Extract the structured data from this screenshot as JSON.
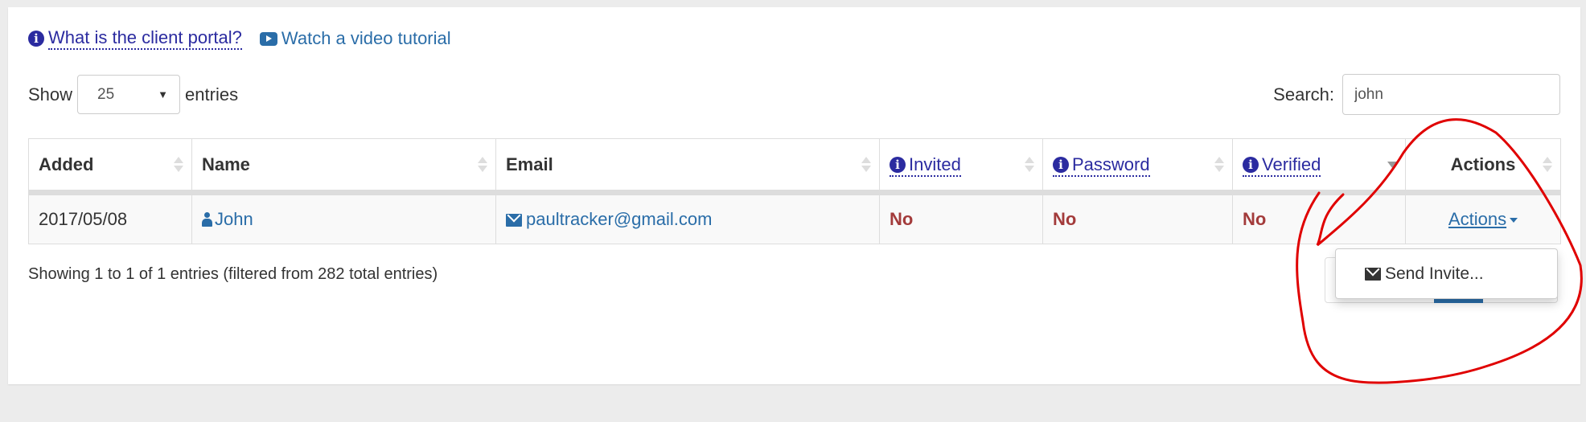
{
  "help_links": {
    "client_portal": {
      "label": "What is the client portal?",
      "icon": "info-circle-icon"
    },
    "video_tutorial": {
      "label": "Watch a video tutorial",
      "icon": "youtube-play-icon"
    }
  },
  "length_control": {
    "prefix": "Show",
    "value": "25",
    "suffix": "entries"
  },
  "search": {
    "label": "Search:",
    "value": "john"
  },
  "table": {
    "columns": [
      {
        "label": "Added",
        "sort": "none"
      },
      {
        "label": "Name",
        "sort": "none"
      },
      {
        "label": "Email",
        "sort": "none"
      },
      {
        "label": "Invited",
        "sort": "none",
        "info": true
      },
      {
        "label": "Password",
        "sort": "none",
        "info": true
      },
      {
        "label": "Verified",
        "sort": "desc",
        "info": true
      },
      {
        "label": "Actions",
        "sort": "none"
      }
    ],
    "rows": [
      {
        "added": "2017/05/08",
        "name": "John",
        "email": "paultracker@gmail.com",
        "invited": "No",
        "password": "No",
        "verified": "No",
        "actions": "Actions"
      }
    ]
  },
  "table_info": "Showing 1 to 1 of 1 entries (filtered from 282 total entries)",
  "actions_menu": {
    "items": [
      {
        "label": "Send Invite...",
        "icon": "envelope-icon"
      }
    ]
  },
  "colors": {
    "link": "#2a6da8",
    "info_link": "#2b2ba0",
    "no_value": "#a33b3b",
    "annotation": "#e00000"
  }
}
